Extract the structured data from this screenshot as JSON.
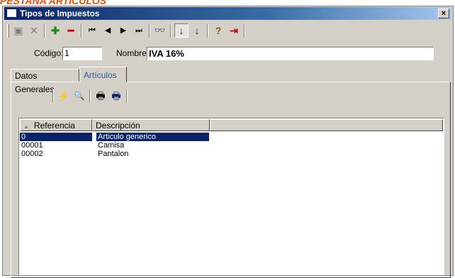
{
  "page_heading": "PESTAÑA ARTÍCULOS",
  "window": {
    "title": "Tipos de Impuestos",
    "close_glyph": "×"
  },
  "toolbar": {
    "items": [
      {
        "icon": "save-icon",
        "glyph": "▣"
      },
      {
        "icon": "cancel-icon",
        "glyph": "✕"
      },
      {
        "icon": "add-icon",
        "glyph": "✚"
      },
      {
        "icon": "remove-icon",
        "glyph": "━"
      },
      {
        "icon": "first-record-icon",
        "glyph": "⏮"
      },
      {
        "icon": "previous-record-icon",
        "glyph": "◀"
      },
      {
        "icon": "next-record-icon",
        "glyph": "▶"
      },
      {
        "icon": "last-record-icon",
        "glyph": "⏭"
      },
      {
        "icon": "find-icon",
        "glyph": "👓"
      },
      {
        "icon": "sort-ascending-icon",
        "glyph": "↓"
      },
      {
        "icon": "sort-descending-icon",
        "glyph": "↓"
      },
      {
        "icon": "help-icon",
        "glyph": "?"
      },
      {
        "icon": "exit-icon",
        "glyph": "⇥"
      }
    ]
  },
  "form": {
    "code_label": "Código:",
    "code_value": "1",
    "name_label": "Nombre:",
    "name_value": "IVA 16%"
  },
  "tabs": [
    {
      "label": "Datos Generales",
      "active": false
    },
    {
      "label": "Artículos",
      "active": true
    }
  ],
  "articles_toolbar": {
    "items": [
      {
        "icon": "execute-icon",
        "glyph": "⚡"
      },
      {
        "icon": "preview-icon",
        "glyph": "🔍"
      },
      {
        "icon": "print-icon",
        "glyph": "🖶"
      },
      {
        "icon": "print-setup-icon",
        "glyph": "🖶"
      }
    ]
  },
  "grid": {
    "columns": [
      "Referencia",
      "Descripción"
    ],
    "sort_glyph": "▲",
    "rows": [
      {
        "ref": "0",
        "desc": "Articulo generico",
        "selected": true
      },
      {
        "ref": "00001",
        "desc": "Camisa",
        "selected": false
      },
      {
        "ref": "00002",
        "desc": "Pantalon",
        "selected": false
      }
    ]
  },
  "colors": {
    "title_bar": "#0a246a",
    "heading": "#e8500c",
    "add": "#1a8c1a",
    "remove": "#cc0000",
    "selection": "#0a246a"
  }
}
